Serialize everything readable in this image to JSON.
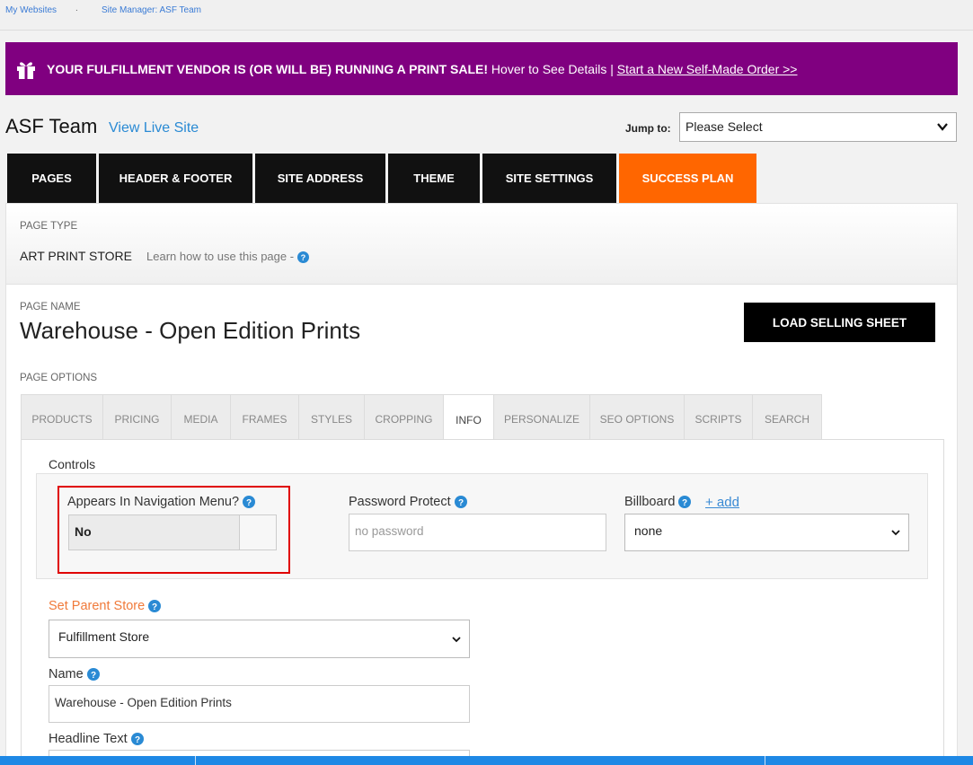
{
  "breadcrumb": {
    "items": [
      "My Websites",
      "Site Manager: ASF Team"
    ],
    "separator": "."
  },
  "banner": {
    "bold_text": "YOUR FULFILLMENT VENDOR IS (OR WILL BE) RUNNING A PRINT SALE!",
    "hover_text": " Hover to See Details | ",
    "link_text": "Start a New Self-Made Order >>",
    "icon": "gift-icon",
    "color": "#800080"
  },
  "header": {
    "site_title": "ASF Team",
    "view_live": "View Live Site",
    "jump_label": "Jump to:",
    "jump_value": "Please Select"
  },
  "main_tabs": [
    {
      "label": "PAGES"
    },
    {
      "label": "HEADER & FOOTER"
    },
    {
      "label": "SITE ADDRESS"
    },
    {
      "label": "THEME"
    },
    {
      "label": "SITE SETTINGS"
    },
    {
      "label": "SUCCESS PLAN",
      "active": true
    }
  ],
  "page_type": {
    "label": "PAGE TYPE",
    "value": "ART PRINT STORE",
    "learn": "Learn how to use this page - "
  },
  "page_name": {
    "label": "PAGE NAME",
    "value": "Warehouse - Open Edition Prints",
    "load_button": "LOAD SELLING SHEET"
  },
  "page_options": {
    "label": "PAGE OPTIONS",
    "tabs": [
      {
        "label": "PRODUCTS"
      },
      {
        "label": "PRICING"
      },
      {
        "label": "MEDIA"
      },
      {
        "label": "FRAMES"
      },
      {
        "label": "STYLES"
      },
      {
        "label": "CROPPING"
      },
      {
        "label": "INFO",
        "active": true
      },
      {
        "label": "PERSONALIZE"
      },
      {
        "label": "SEO OPTIONS"
      },
      {
        "label": "SCRIPTS"
      },
      {
        "label": "SEARCH"
      }
    ]
  },
  "controls": {
    "title": "Controls",
    "nav_label": "Appears In Navigation Menu?",
    "nav_value": "No",
    "password_label": "Password Protect",
    "password_placeholder": "no password",
    "billboard_label": "Billboard",
    "billboard_add": "+ add",
    "billboard_value": "none"
  },
  "form": {
    "parent_label": "Set Parent Store",
    "parent_value": "Fulfillment Store",
    "name_label": "Name",
    "name_value": "Warehouse - Open Edition Prints",
    "headline_label": "Headline Text"
  },
  "colors": {
    "accent_orange": "#ff6600",
    "banner_purple": "#800080",
    "link_blue": "#2a8ad4",
    "highlight_red": "#e00000"
  }
}
